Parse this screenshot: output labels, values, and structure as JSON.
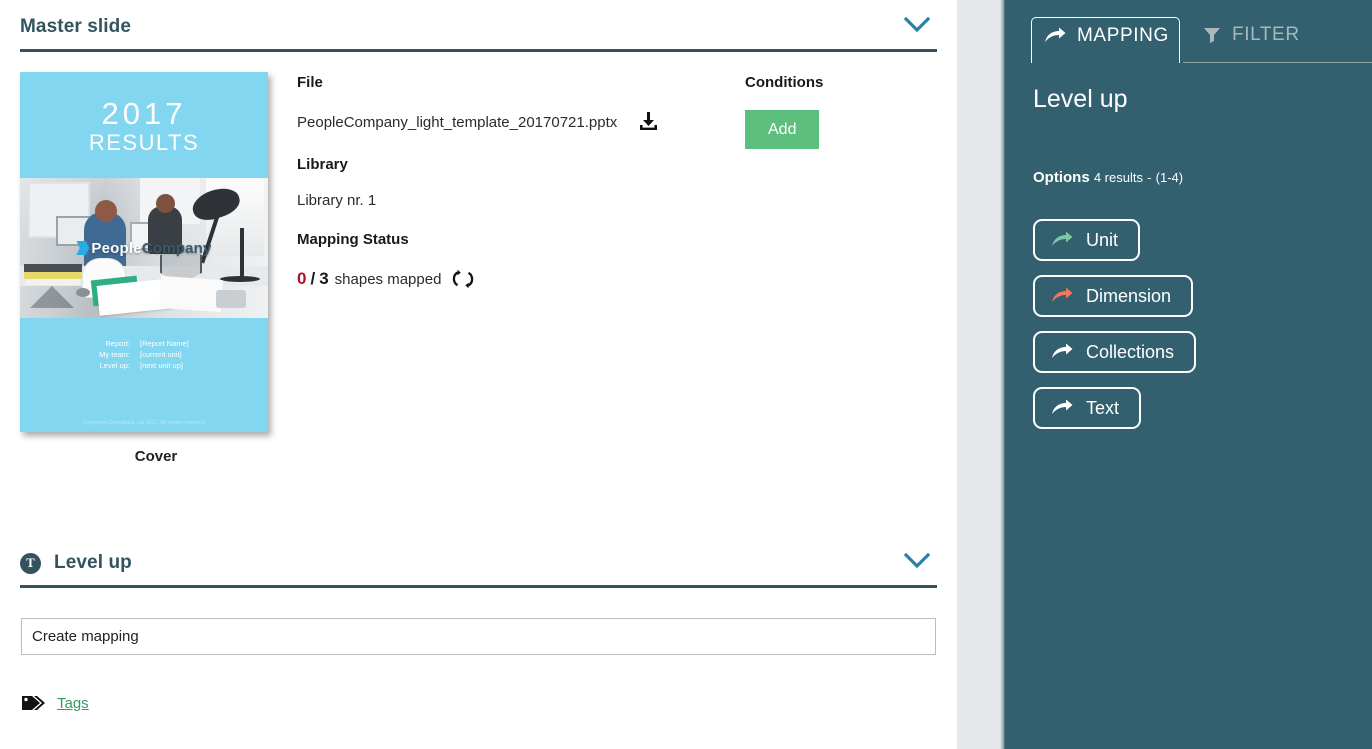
{
  "main": {
    "header": {
      "title": "Master slide",
      "chevron_icon": "chevron-down-icon"
    },
    "slide": {
      "year": "2017",
      "subtitle": "RESULTS",
      "logo_mark": "people-company-logo-icon",
      "logo_text_light": "People",
      "logo_text_dark": "Company",
      "fields": [
        {
          "label": "Report:",
          "value": "[Report Name]"
        },
        {
          "label": "My team:",
          "value": "[current unit]"
        },
        {
          "label": "Level up:",
          "value": "[next unit up]"
        }
      ],
      "copyright": "Copyright Questback Ltd 2017, All rights reserved",
      "caption": "Cover"
    },
    "file": {
      "label": "File",
      "name": "PeopleCompany_light_template_20170721.pptx",
      "download_icon": "download-icon"
    },
    "library": {
      "label": "Library",
      "value": "Library nr. 1"
    },
    "mapping_status": {
      "label": "Mapping Status",
      "mapped": "0",
      "separator": "/",
      "total": "3",
      "text": "shapes mapped",
      "refresh_icon": "refresh-icon",
      "mapped_color": "#b31229"
    },
    "conditions": {
      "label": "Conditions",
      "add_label": "Add",
      "add_color": "#5cbf7e"
    },
    "section2": {
      "icon": "text-circle-icon",
      "icon_letter": "T",
      "title": "Level up",
      "chevron_icon": "chevron-down-icon"
    },
    "create_mapping": {
      "value": "Create mapping",
      "placeholder": "Create mapping"
    },
    "tags": {
      "icon": "tag-icon",
      "label": "Tags",
      "color": "#2f9e5e"
    }
  },
  "right_panel": {
    "background": "#33606e",
    "tabs": [
      {
        "label": "MAPPING",
        "icon": "arrow-mapping-icon",
        "active": true
      },
      {
        "label": "FILTER",
        "icon": "filter-funnel-icon",
        "active": false
      }
    ],
    "title": "Level up",
    "options": {
      "label": "Options",
      "results": "4 results",
      "dash": "-",
      "range": "(1-4)"
    },
    "option_buttons": [
      {
        "label": "Unit",
        "icon": "arrow-icon",
        "arrow_color": "#7cc6a4"
      },
      {
        "label": "Dimension",
        "icon": "arrow-icon",
        "arrow_color": "#f2785c"
      },
      {
        "label": "Collections",
        "icon": "arrow-icon",
        "arrow_color": "#ffffff"
      },
      {
        "label": "Text",
        "icon": "arrow-icon",
        "arrow_color": "#ffffff"
      }
    ]
  }
}
